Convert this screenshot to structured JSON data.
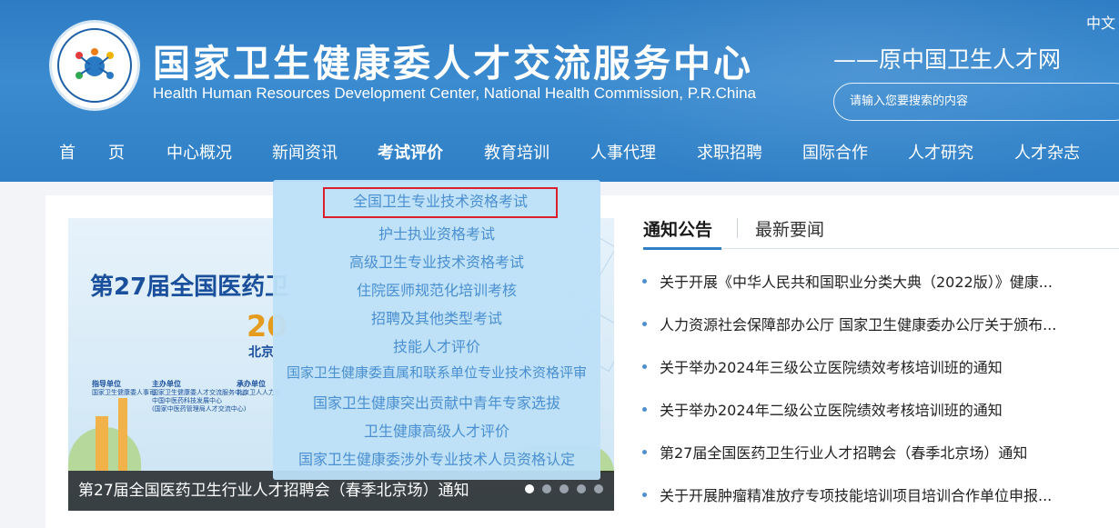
{
  "header": {
    "title_cn": "国家卫生健康委人才交流服务中心",
    "title_en": "Health Human Resources Development Center, National Health Commission, P.R.China",
    "lang": "中文",
    "slogan": "——原中国卫生人才网",
    "search_placeholder": "请输入您要搜索的内容"
  },
  "nav": {
    "items": [
      "首　　页",
      "中心概况",
      "新闻资讯",
      "考试评价",
      "教育培训",
      "人事代理",
      "求职招聘",
      "国际合作",
      "人才研究",
      "人才杂志"
    ],
    "active": "考试评价"
  },
  "dropdown": {
    "items": [
      "全国卫生专业技术资格考试",
      "护士执业资格考试",
      "高级卫生专业技术资格考试",
      "住院医师规范化培训考核",
      "招聘及其他类型考试",
      "技能人才评价",
      "国家卫生健康委直属和联系单位专业技术资格评审",
      "国家卫生健康突出贡献中青年专家选拔",
      "卫生健康高级人才评价",
      "国家卫生健康委涉外专业技术人员资格认定"
    ],
    "highlighted_index": 0
  },
  "banner": {
    "title": "第27届全国医药卫",
    "year": "20",
    "city": "北京",
    "orgs": {
      "guide": "指导单位",
      "guide_text": "国家卫生健康委人事司",
      "host": "主办单位",
      "host_text": "国家卫生健康委人才交流服务中心",
      "host_text2": "中国中医药科技发展中心",
      "host_text3": "(国家中医药管理局人才交流中心)",
      "undertake": "承办单位",
      "undertake_text": "北京卫人人力资"
    },
    "caption": "第27届全国医药卫生行业人才招聘会（春季北京场）通知",
    "slides": 5,
    "active_slide": 0
  },
  "notices": {
    "tabs": [
      "通知公告",
      "最新要闻"
    ],
    "active_tab": "通知公告",
    "items": [
      "关于开展《中华人民共和国职业分类大典（2022版）》健康...",
      "人力资源社会保障部办公厅 国家卫生健康委办公厅关于颁布...",
      "关于举办2024年三级公立医院绩效考核培训班的通知",
      "关于举办2024年二级公立医院绩效考核培训班的通知",
      "第27届全国医药卫生行业人才招聘会（春季北京场）通知",
      "关于开展肿瘤精准放疗专项技能培训项目培训合作单位申报..."
    ]
  },
  "colors": {
    "header_blue": "#2f7fc6",
    "dropdown_bg": "#bde0f8",
    "dropdown_text": "#4a8fd0",
    "highlight_border": "#d9202c"
  }
}
